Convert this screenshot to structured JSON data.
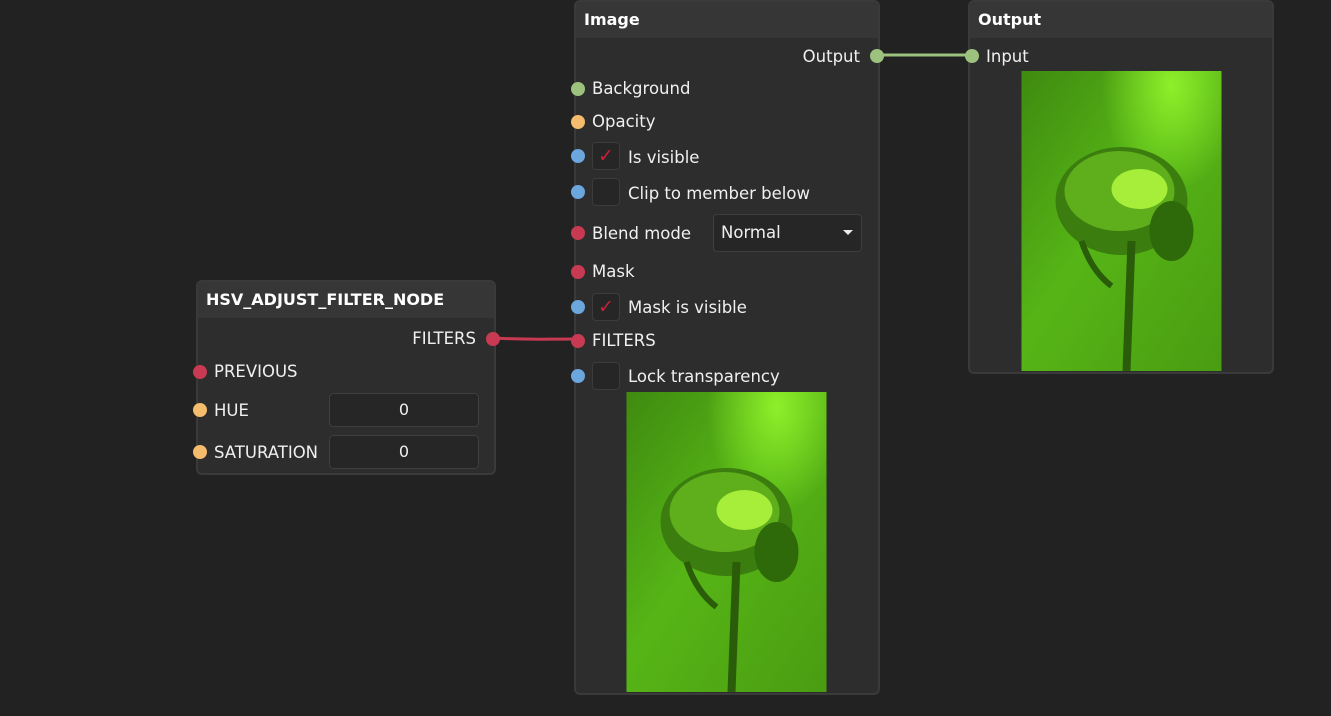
{
  "hsv_node": {
    "title": "HSV_ADJUST_FILTER_NODE",
    "output_label": "FILTERS",
    "inputs": {
      "previous": "PREVIOUS",
      "hue": "HUE",
      "saturation": "SATURATION"
    },
    "hue_value": "0",
    "saturation_value": "0"
  },
  "image_node": {
    "title": "Image",
    "output_label": "Output",
    "inputs": {
      "background": "Background",
      "opacity": "Opacity",
      "is_visible": "Is visible",
      "clip": "Clip to member below",
      "blend_mode": "Blend mode",
      "mask": "Mask",
      "mask_visible": "Mask is visible",
      "filters": "FILTERS",
      "lock_transparency": "Lock transparency"
    },
    "is_visible_checked": true,
    "clip_checked": false,
    "mask_visible_checked": true,
    "lock_transparency_checked": false,
    "blend_mode_value": "Normal",
    "check_glyph": "✓"
  },
  "output_node": {
    "title": "Output",
    "input_label": "Input"
  },
  "colors": {
    "background": "#222222",
    "node_body": "#2d2d2d",
    "socket_image": "#9cc27e",
    "socket_float": "#f4bc6c",
    "socket_bool": "#6ba6dc",
    "socket_filter": "#c83a52",
    "wire_image": "#9cc27e",
    "wire_filter": "#c83a52"
  },
  "icons": {
    "checkbox_check": "check-icon",
    "dropdown_arrow": "chevron-down-icon"
  }
}
